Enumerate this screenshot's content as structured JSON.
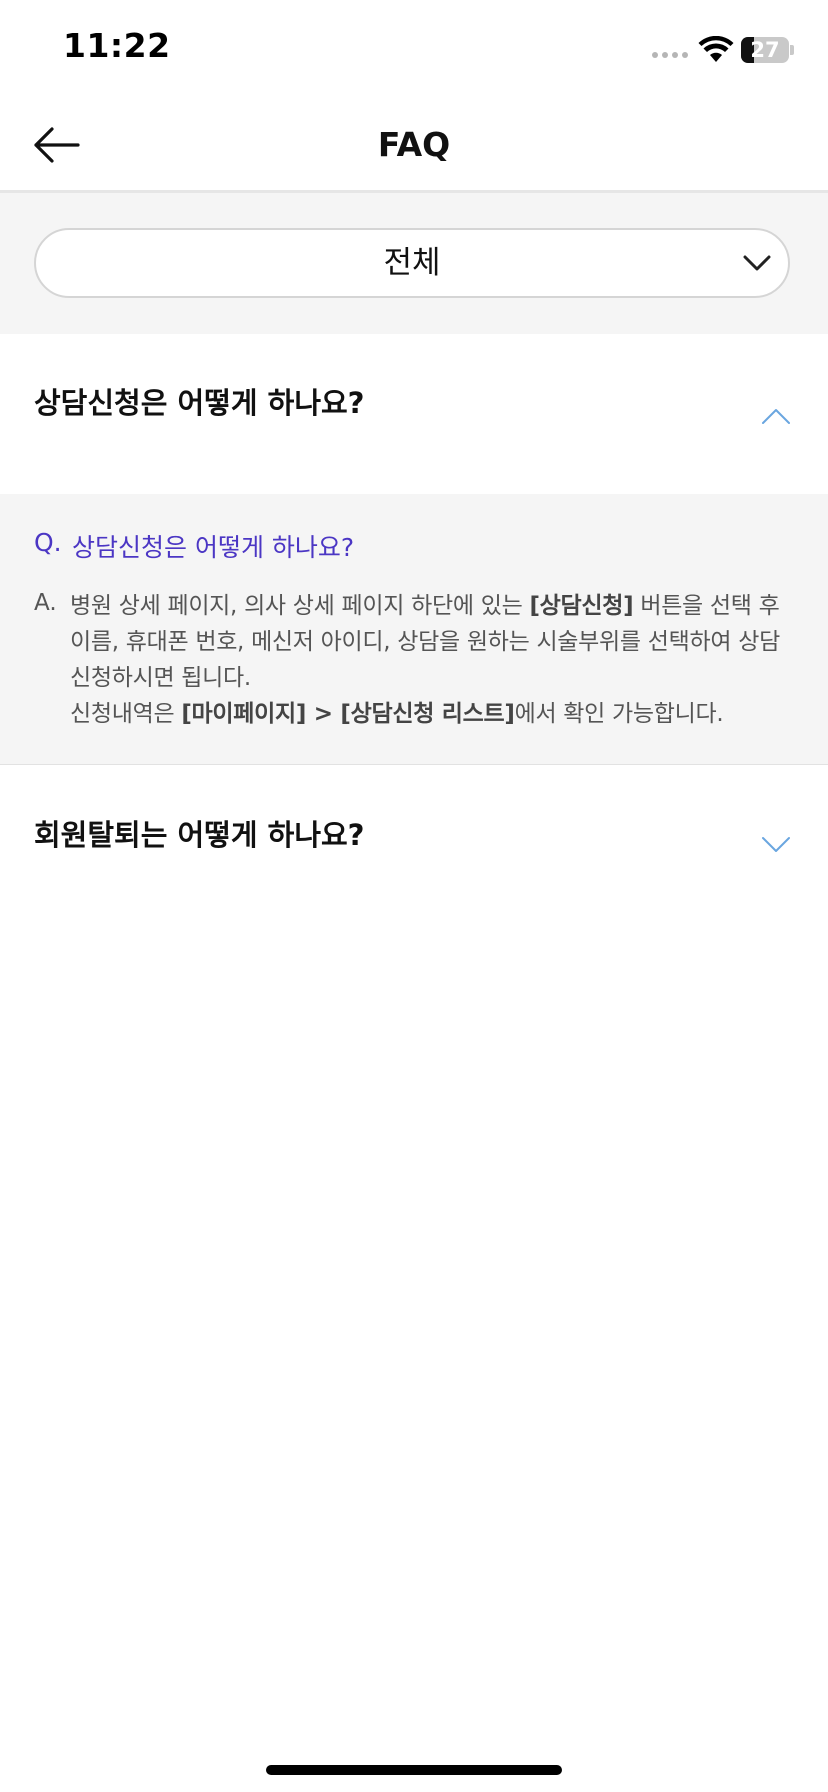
{
  "status_bar": {
    "time": "11:22",
    "battery_level": "27",
    "battery_fraction": 0.27
  },
  "header": {
    "title": "FAQ",
    "back_icon": "arrow-left-icon"
  },
  "filter": {
    "selected": "전체",
    "chevron_icon": "chevron-down-icon"
  },
  "faq_items": [
    {
      "question": "상담신청은 어떻게 하나요?",
      "expanded": true,
      "chevron_icon": "chevron-up-icon",
      "detail": {
        "q_prefix": "Q.",
        "q_text": "상담신청은 어떻게 하나요?",
        "a_prefix": "A.",
        "a_part1": "병원 상세 페이지, 의사 상세 페이지 하단에 있는 ",
        "a_bold1": "[상담신청]",
        "a_part2": " 버튼을 선택 후 이름, 휴대폰 번호, 메신저 아이디, 상담을 원하는 시술부위를 선택하여 상담 신청하시면 됩니다.",
        "a_line2_part1": "신청내역은 ",
        "a_bold2": "[마이페이지] > [상담신청 리스트]",
        "a_line2_part2": "에서 확인 가능합니다."
      }
    },
    {
      "question": "회원탈퇴는 어떻게 하나요?",
      "expanded": false,
      "chevron_icon": "chevron-down-icon"
    }
  ],
  "colors": {
    "accent": "#4b36c4",
    "chevron": "#6aa6e0",
    "panel_bg": "#f5f5f5"
  }
}
